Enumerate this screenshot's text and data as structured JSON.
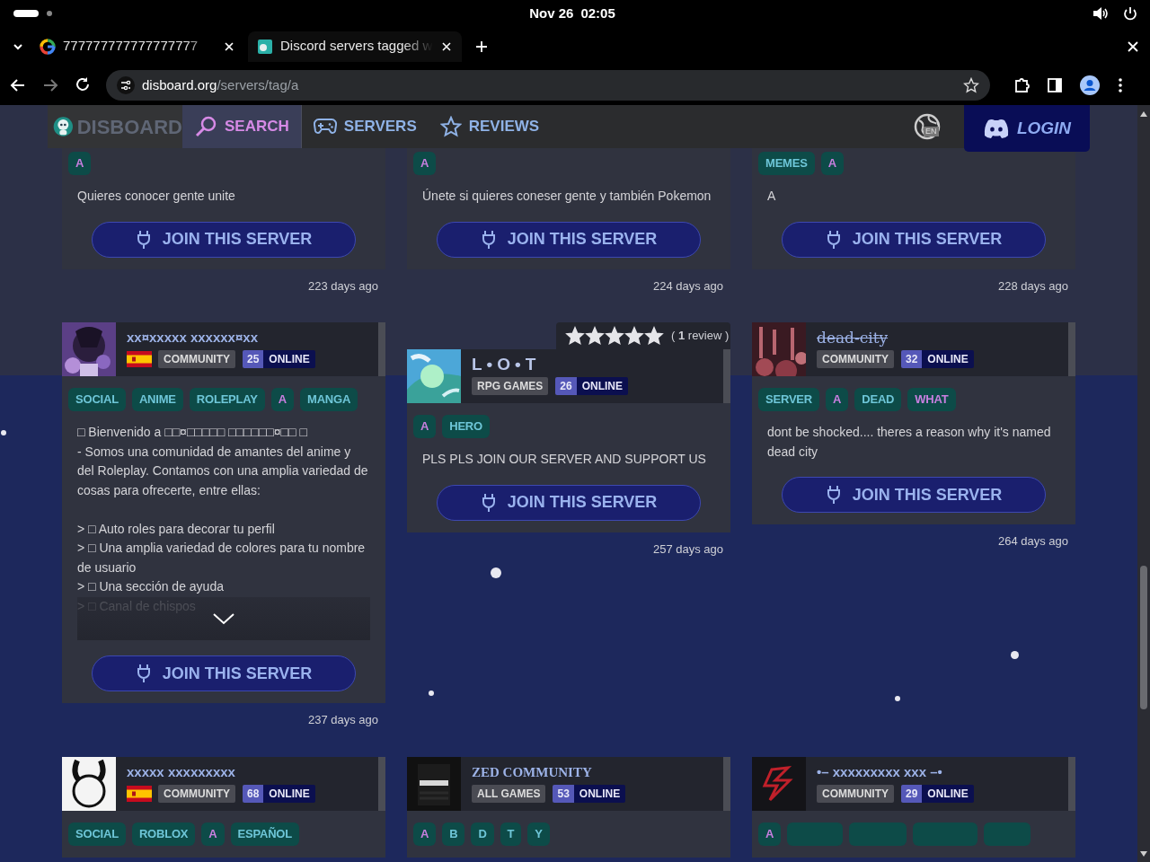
{
  "os_bar": {
    "date": "Nov 26",
    "time": "02:05"
  },
  "browser": {
    "tabs": [
      {
        "title": "777777777777777777",
        "selected": false
      },
      {
        "title": "Discord servers tagged w",
        "selected": true
      }
    ],
    "url_host": "disboard.org",
    "url_path": "/servers/tag/a"
  },
  "nav": {
    "logo": "DISBOARD",
    "items": [
      {
        "label": "SEARCH",
        "selected": true
      },
      {
        "label": "SERVERS",
        "selected": false
      },
      {
        "label": "REVIEWS",
        "selected": false
      }
    ],
    "language": "EN",
    "login": "LOGIN"
  },
  "rows": [
    [
      {
        "tags": [
          {
            "kind": "text",
            "label": "A",
            "highlighted": true
          }
        ],
        "description": "Quieres conocer gente unite",
        "truncated": false,
        "join": "JOIN THIS SERVER",
        "time": "223 days ago"
      },
      {
        "tags": [
          {
            "kind": "text",
            "label": "A",
            "highlighted": true
          }
        ],
        "description": "Únete si quieres coneser gente y también Pokemon",
        "truncated": false,
        "join": "JOIN THIS SERVER",
        "time": "224 days ago"
      },
      {
        "tags": [
          {
            "kind": "text",
            "label": "MEMES",
            "highlighted": false
          },
          {
            "kind": "text",
            "label": "A",
            "highlighted": true
          }
        ],
        "description": "A",
        "truncated": false,
        "join": "JOIN THIS SERVER",
        "time": "228 days ago"
      }
    ],
    [
      {
        "name": "xx¤xxxxx xxxxxx¤xx",
        "flag": true,
        "category": "COMMUNITY",
        "online": "25",
        "online_label": "ONLINE",
        "tags": [
          {
            "kind": "text",
            "label": "SOCIAL",
            "highlighted": false
          },
          {
            "kind": "text",
            "label": "ANIME",
            "highlighted": false
          },
          {
            "kind": "text",
            "label": "ROLEPLAY",
            "highlighted": false
          },
          {
            "kind": "text",
            "label": "A",
            "highlighted": true
          },
          {
            "kind": "text",
            "label": "MANGA",
            "highlighted": false
          }
        ],
        "description": "□ Bienvenido a □□¤□□□□□ □□□□□□¤□□ □\n- Somos una comunidad de amantes del anime y del Roleplay. Contamos con una amplia variedad de cosas para ofrecerte, entre ellas:\n\n> □ Auto roles para decorar tu perfil\n> □ Una amplia variedad de colores para tu nombre de usuario\n> □ Una sección de ayuda\n> □ Canal de chispos",
        "truncated": true,
        "join": "JOIN THIS SERVER",
        "time": "237 days ago"
      },
      {
        "reviews": {
          "stars": 5,
          "text": "( **1** review )"
        },
        "name": "L•O•T",
        "flag": false,
        "category": "RPG GAMES",
        "online": "26",
        "online_label": "ONLINE",
        "tags": [
          {
            "kind": "text",
            "label": "A",
            "highlighted": true
          },
          {
            "kind": "text",
            "label": "HERO",
            "highlighted": false
          }
        ],
        "description": "PLS PLS JOIN OUR SERVER AND SUPPORT US",
        "truncated": false,
        "join": "JOIN THIS SERVER",
        "time": "257 days ago"
      },
      {
        "name": "dead-city",
        "flag": false,
        "category": "COMMUNITY",
        "online": "32",
        "online_label": "ONLINE",
        "tags": [
          {
            "kind": "text",
            "label": "SERVER",
            "highlighted": false
          },
          {
            "kind": "text",
            "label": "A",
            "highlighted": true
          },
          {
            "kind": "text",
            "label": "DEAD",
            "highlighted": false
          },
          {
            "kind": "text",
            "label": "WHAT",
            "highlighted": true
          }
        ],
        "description": "dont be shocked.... theres a reason why it's named dead city",
        "truncated": false,
        "join": "JOIN THIS SERVER",
        "time": "264 days ago"
      }
    ],
    [
      {
        "name": "xxxxx xxxxxxxxx",
        "flag": true,
        "category": "COMMUNITY",
        "online": "68",
        "online_label": "ONLINE",
        "tags": [
          {
            "kind": "text",
            "label": "SOCIAL",
            "highlighted": false
          },
          {
            "kind": "text",
            "label": "ROBLOX",
            "highlighted": false
          },
          {
            "kind": "text",
            "label": "A",
            "highlighted": true
          },
          {
            "kind": "text",
            "label": "ESPAÑOL",
            "highlighted": false
          }
        ]
      },
      {
        "name": "ZED COMMUNITY",
        "flag": false,
        "category": "ALL GAMES",
        "online": "53",
        "online_label": "ONLINE",
        "tags": [
          {
            "kind": "text",
            "label": "A",
            "highlighted": true
          },
          {
            "kind": "text",
            "label": "B",
            "highlighted": false
          },
          {
            "kind": "text",
            "label": "D",
            "highlighted": false
          },
          {
            "kind": "text",
            "label": "T",
            "highlighted": false
          },
          {
            "kind": "text",
            "label": "Y",
            "highlighted": false
          }
        ]
      },
      {
        "name": "•– xxxxxxxxx xxx –•",
        "flag": false,
        "category": "COMMUNITY",
        "online": "29",
        "online_label": "ONLINE",
        "tags": [
          {
            "kind": "text",
            "label": "A",
            "highlighted": true
          },
          {
            "kind": "placeholder"
          },
          {
            "kind": "placeholder"
          },
          {
            "kind": "placeholder"
          },
          {
            "kind": "placeholder"
          }
        ]
      }
    ]
  ]
}
